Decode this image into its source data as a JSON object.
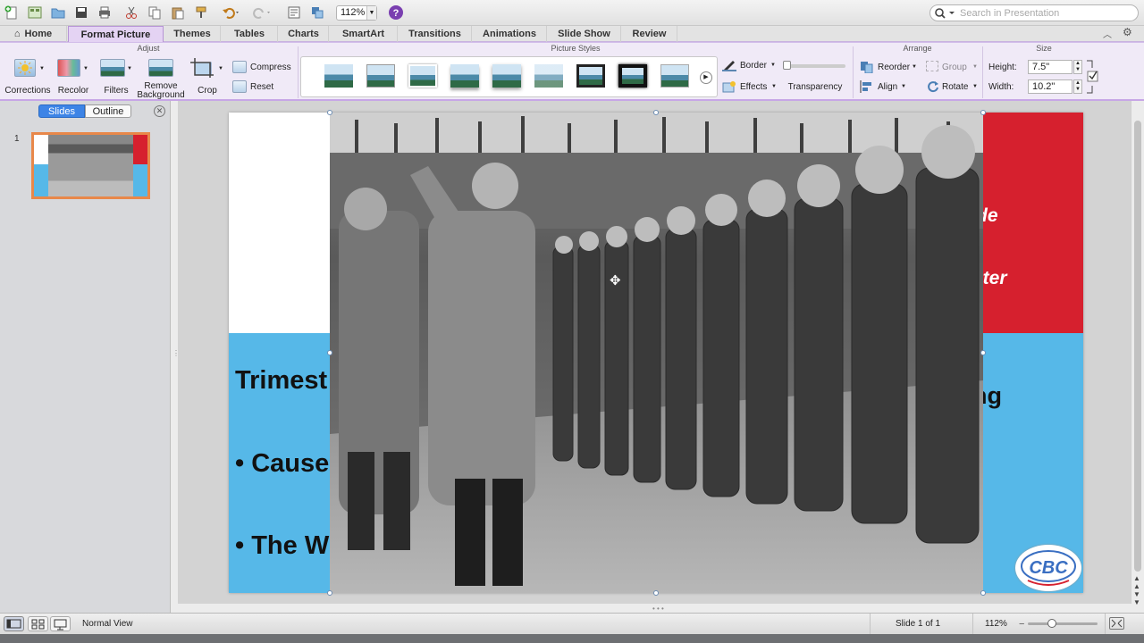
{
  "toolbar": {
    "zoom_value": "112%",
    "search_placeholder": "Search in Presentation"
  },
  "tabs": [
    {
      "label": "Home"
    },
    {
      "label": "Format Picture",
      "active": true
    },
    {
      "label": "Themes"
    },
    {
      "label": "Tables"
    },
    {
      "label": "Charts"
    },
    {
      "label": "SmartArt"
    },
    {
      "label": "Transitions"
    },
    {
      "label": "Animations"
    },
    {
      "label": "Slide Show"
    },
    {
      "label": "Review"
    }
  ],
  "ribbon": {
    "adjust": {
      "title": "Adjust",
      "corrections": "Corrections",
      "recolor": "Recolor",
      "filters": "Filters",
      "remove_background_1": "Remove",
      "remove_background_2": "Background",
      "crop": "Crop",
      "compress": "Compress",
      "reset": "Reset"
    },
    "picture_styles": {
      "title": "Picture Styles",
      "border": "Border",
      "effects": "Effects",
      "transparency": "Transparency",
      "transparency_level": 0
    },
    "arrange": {
      "title": "Arrange",
      "reorder": "Reorder",
      "group": "Group",
      "align": "Align",
      "rotate": "Rotate"
    },
    "size": {
      "title": "Size",
      "height_label": "Height:",
      "height_value": "7.5\"",
      "width_label": "Width:",
      "width_value": "10.2\""
    }
  },
  "left_pane": {
    "slides_tab": "Slides",
    "outline_tab": "Outline",
    "slide_number": "1"
  },
  "slide": {
    "text_trimest": "Trimest",
    "text_causes": "• Causes",
    "text_the_w": "• The W",
    "text_de": "de",
    "text_ster": "ster",
    "text_ng": "ng",
    "logo_text": "CBC",
    "colors": {
      "red": "#d6202e",
      "blue": "#56b8e8"
    }
  },
  "status": {
    "view_name": "Normal View",
    "slide_counter": "Slide 1 of 1",
    "zoom_value": "112%",
    "zoom_level": 0.35
  }
}
